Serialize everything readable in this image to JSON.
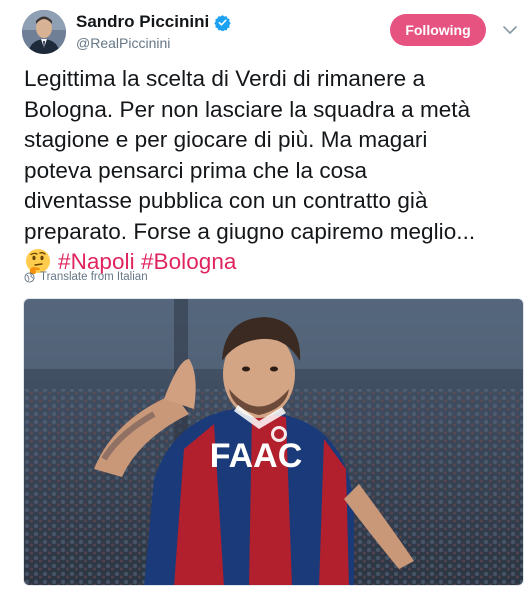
{
  "author": {
    "display_name": "Sandro Piccinini",
    "handle": "@RealPiccinini",
    "verified_icon": "verified-badge-icon"
  },
  "follow_button": {
    "label": "Following",
    "color": "#e0245e"
  },
  "menu_icon": "chevron-down-icon",
  "tweet": {
    "lines": [
      "Legittima la scelta di Verdi di rimanere a",
      "Bologna. Per non lasciare la squadra a metà",
      "stagione e per giocare di più. Ma magari",
      "poteva pensarci prima che la cosa",
      "diventasse pubblica con un contratto già",
      "preparato. Forse a giugno capiremo meglio..."
    ],
    "emoji": "thinking-face-icon",
    "hashtags": [
      "#Napoli",
      "#Bologna"
    ]
  },
  "translate": {
    "label": "Translate from Italian",
    "icon": "globe-icon"
  },
  "media": {
    "description_icon": "soccer-player-photo",
    "shirt_text": "FAAC"
  },
  "colors": {
    "text": "#14171a",
    "secondary": "#657786",
    "hashtag": "#e0245e",
    "verified": "#1da1f2"
  }
}
